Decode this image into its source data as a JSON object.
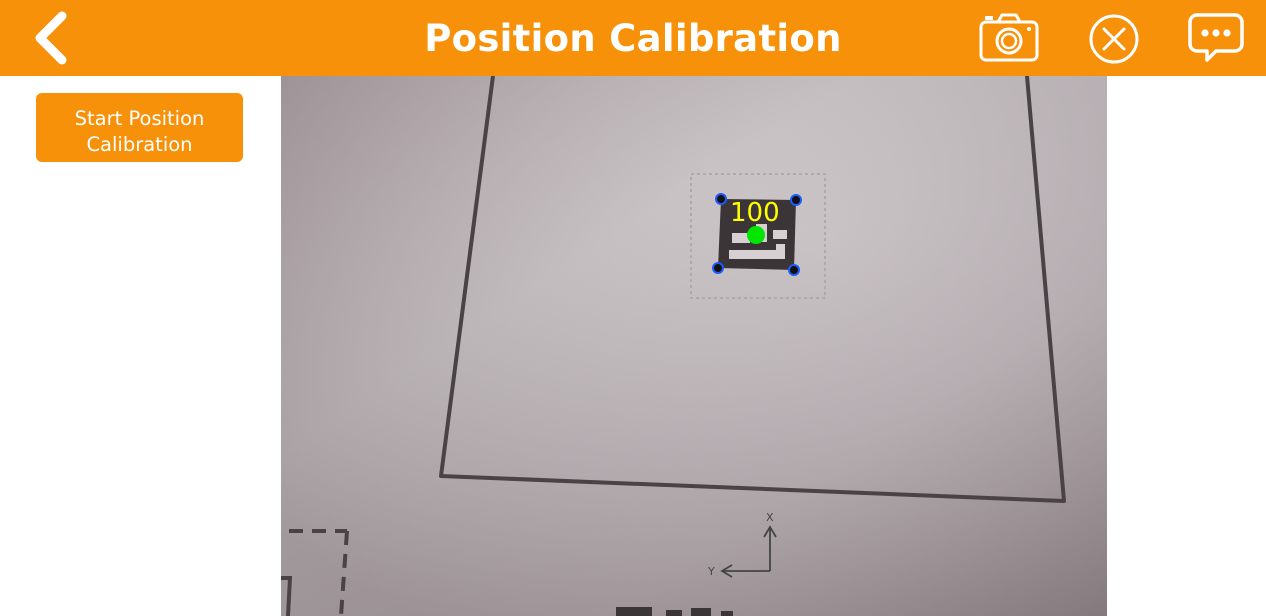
{
  "header": {
    "title": "Position Calibration",
    "back_icon": "chevron-left-icon",
    "actions": [
      {
        "icon": "camera-icon"
      },
      {
        "icon": "close-circle-icon"
      },
      {
        "icon": "chat-bubble-icon"
      }
    ],
    "background_color": "#f7910a",
    "text_color": "#ffffff"
  },
  "sidebar": {
    "start_button_label": "Start Position Calibration"
  },
  "camera_view": {
    "marker_id": "100",
    "marker_label_color": "#ffff00",
    "marker_center_color": "#00e600",
    "marker_corner_color": "#1a5cff",
    "axis_x_label": "X",
    "axis_y_label": "Y"
  }
}
